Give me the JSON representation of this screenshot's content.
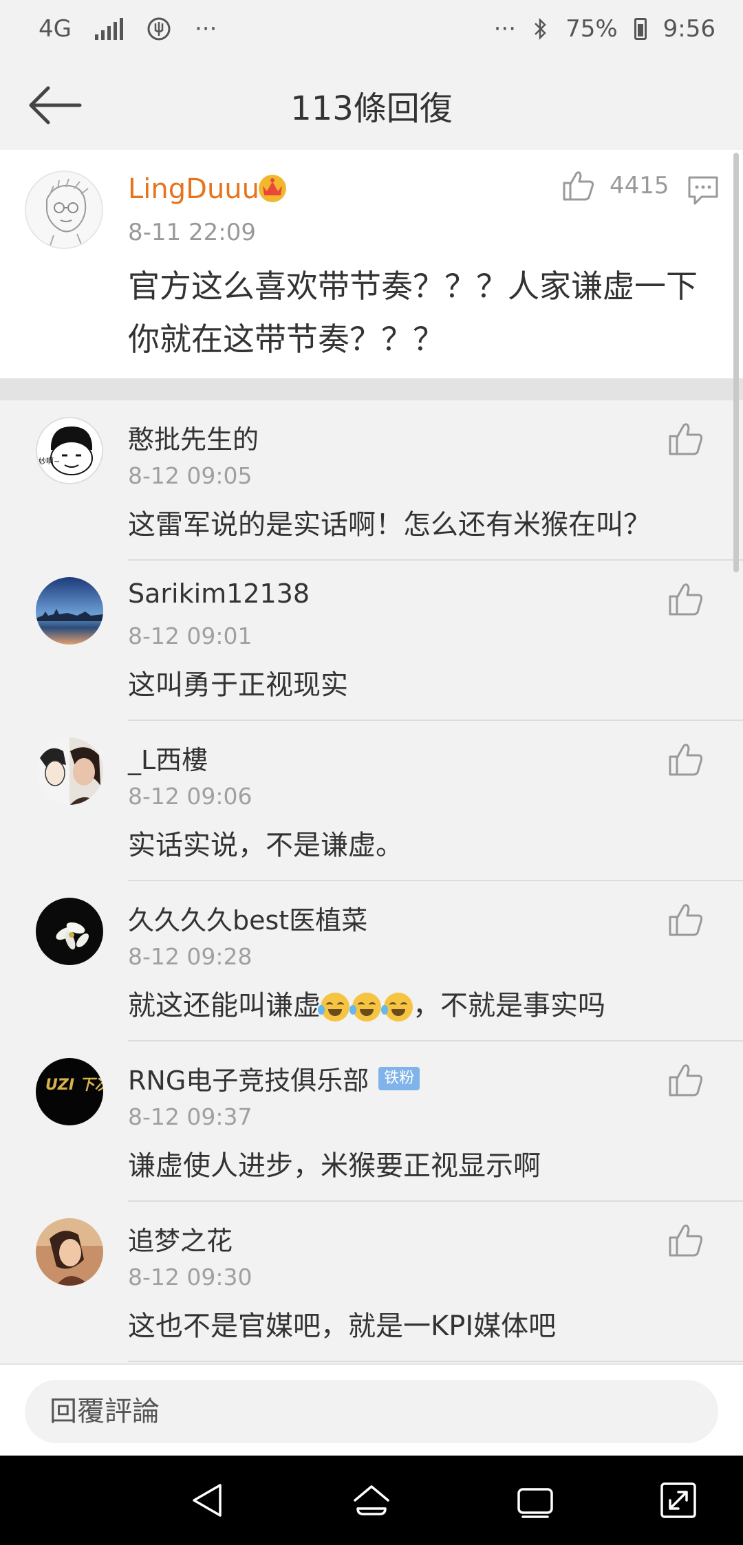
{
  "status_bar": {
    "network": "4G",
    "icons": [
      "signal-icon",
      "compass-icon"
    ],
    "left_more": "···",
    "right_more": "···",
    "battery": "75%",
    "time": "9:56"
  },
  "header": {
    "title": "113條回復"
  },
  "main_comment": {
    "user": "LingDuuu",
    "time": "8-11 22:09",
    "likes": "4415",
    "text": "官方这么喜欢带节奏？？？人家谦虚一下你就在这带节奏？？？"
  },
  "replies": [
    {
      "user": "憨批先生的",
      "time": "8-12 09:05",
      "text": "这雷军说的是实话啊！怎么还有米猴在叫？"
    },
    {
      "user": "Sarikim12138",
      "time": "8-12 09:01",
      "text": "这叫勇于正视现实"
    },
    {
      "user": "_L西樓",
      "time": "8-12 09:06",
      "text": "实话实说，不是谦虚。"
    },
    {
      "user": "久久久久best医植菜",
      "time": "8-12 09:28",
      "text_before": "就这还能叫谦虚",
      "text_after": "，不就是事实吗"
    },
    {
      "user": "RNG电子竞技俱乐部",
      "badge": "铁粉",
      "time": "8-12 09:37",
      "text": "谦虚使人进步，米猴要正视显示啊"
    },
    {
      "user": "追梦之花",
      "time": "8-12 09:30",
      "text": "这也不是官媒吧，就是一KPI媒体吧"
    }
  ],
  "avatars": {
    "reply_5_text": "UZI 下次再见 又会"
  },
  "input": {
    "placeholder": "回覆評論"
  }
}
